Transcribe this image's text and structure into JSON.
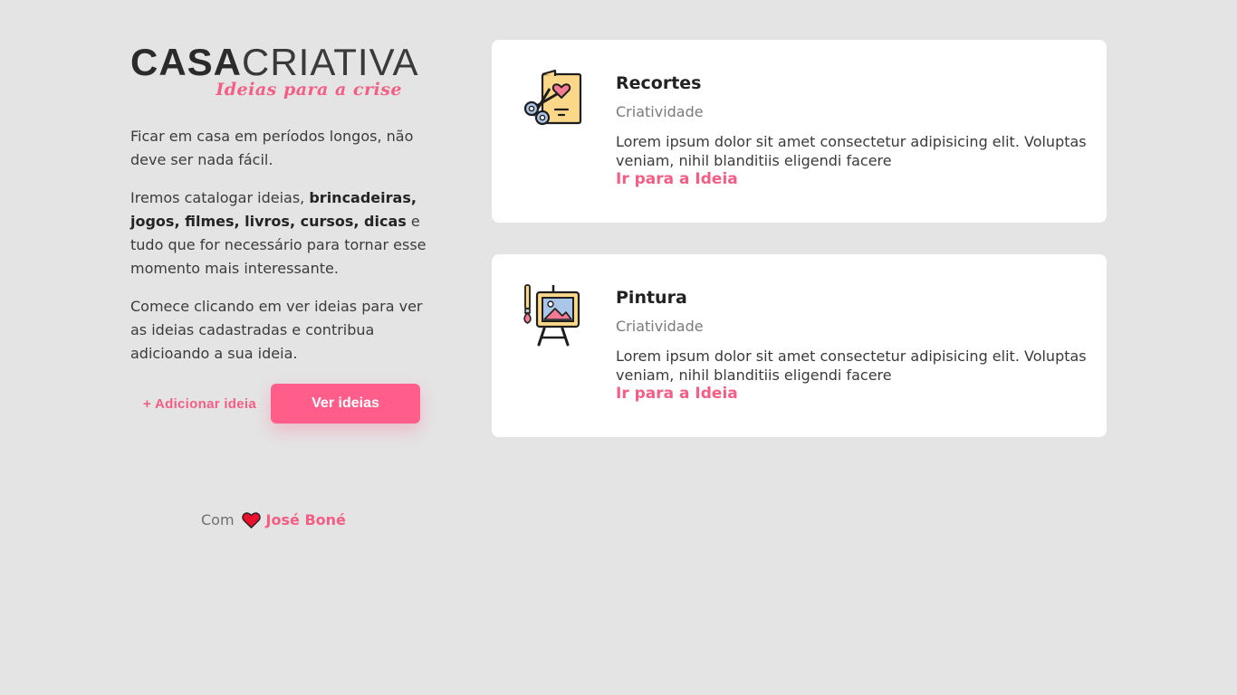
{
  "brand": {
    "logo_bold": "CASA",
    "logo_light": "CRIATIVA",
    "tagline": "Ideias para a crise"
  },
  "intro": {
    "p1": "Ficar em casa em períodos longos, não deve ser nada fácil.",
    "p2_start": "Iremos catalogar ideias,",
    "p2_bold": "brincadeiras, jogos, filmes, livros, cursos, dicas",
    "p2_end": "e tudo que for necessário para tornar esse momento mais interessante.",
    "p3": "Comece clicando em ver ideias para ver as ideias cadastradas e contribua adicioando a sua ideia."
  },
  "actions": {
    "add_label": "+ Adicionar ideia",
    "view_label": "Ver ideias"
  },
  "footer": {
    "with": "Com",
    "heart_icon": "heart-icon",
    "author": "José Boné"
  },
  "ideas": [
    {
      "icon": "scissors-card-icon",
      "title": "Recortes",
      "category": "Criatividade",
      "description": "Lorem ipsum dolor sit amet consectetur adipisicing elit. Voluptas veniam, nihil blanditiis eligendi facere",
      "link": "Ir para a Ideia"
    },
    {
      "icon": "easel-paintbrush-icon",
      "title": "Pintura",
      "category": "Criatividade",
      "description": "Lorem ipsum dolor sit amet consectetur adipisicing elit. Voluptas veniam, nihil blanditiis eligendi facere",
      "link": "Ir para a Ideia"
    }
  ],
  "colors": {
    "background": "#e4e4e4",
    "accent": "#ff5d8a",
    "accent_text": "#f45e85",
    "card": "#ffffff"
  }
}
